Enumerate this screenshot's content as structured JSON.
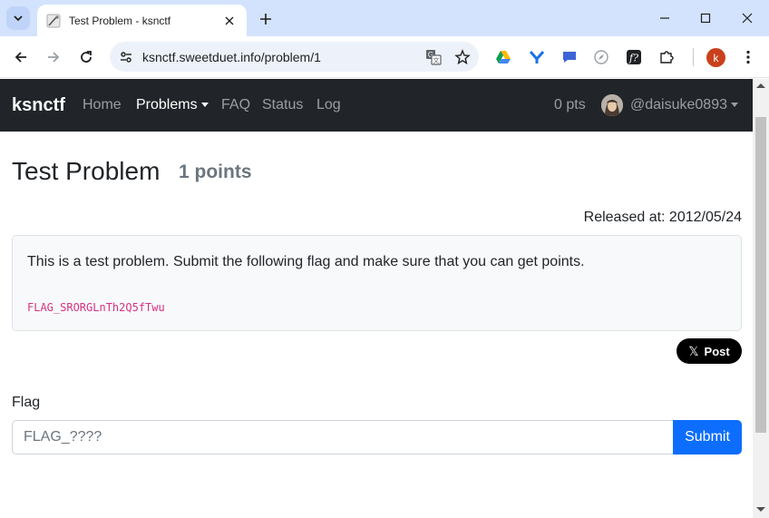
{
  "browser": {
    "tab_title": "Test Problem - ksnctf",
    "url": "ksnctf.sweetduet.info/problem/1",
    "profile_initial": "k"
  },
  "nav": {
    "brand": "ksnctf",
    "links": [
      "Home",
      "Problems",
      "FAQ",
      "Status",
      "Log"
    ],
    "active": "Problems",
    "points": "0 pts",
    "username": "@daisuke0893"
  },
  "problem": {
    "title": "Test Problem",
    "points": "1 points",
    "released": "Released at: 2012/05/24",
    "description": "This is a test problem. Submit the following flag and make sure that you can get points.",
    "flag_code": "FLAG_SRORGLnTh2Q5fTwu",
    "post_label": "Post"
  },
  "form": {
    "label": "Flag",
    "placeholder": "FLAG_????",
    "submit_label": "Submit"
  },
  "colors": {
    "navbar": "#212529",
    "accent": "#0d6efd",
    "code": "#d63384",
    "tabstrip": "#d3e3fd"
  }
}
